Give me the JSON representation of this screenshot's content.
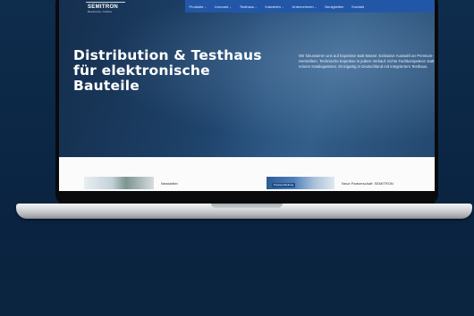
{
  "site": {
    "logo_text": "SEMITRON",
    "logo_sub": "Bauelemente • Testhaus"
  },
  "nav": {
    "items": [
      {
        "label": "Produkte",
        "chevron": true
      },
      {
        "label": "Linecard",
        "chevron": true
      },
      {
        "label": "Testhaus",
        "chevron": true
      },
      {
        "label": "Industrien",
        "chevron": true
      },
      {
        "label": "Unternehmen",
        "chevron": true
      },
      {
        "label": "Neuigkeiten",
        "chevron": false
      },
      {
        "label": "Kontakt",
        "chevron": false
      }
    ],
    "chevron_glyph": "⌄"
  },
  "hero": {
    "title_line1": "Distribution & Testhaus",
    "title_line2": "für elektronische",
    "title_line3": "Bauteile",
    "text": "Wir fokussieren uns auf Expertise statt Masse: Exklusive Auswahl an Premium-Herstellern. Technische Expertise in jedem Verkauf. Echte Fachkompetenz statt reinem Katalogwissen. Einzigartig in Deutschland mit integriertem Testhaus."
  },
  "cards": {
    "left_label": "Newsletter",
    "right_badge": "Pressemitteilung",
    "right_label": "Neue Partnerschaft: SEMITRON"
  },
  "colors": {
    "background": "#0b2745",
    "navbar": "#2257a8",
    "hero": "#25507e"
  }
}
